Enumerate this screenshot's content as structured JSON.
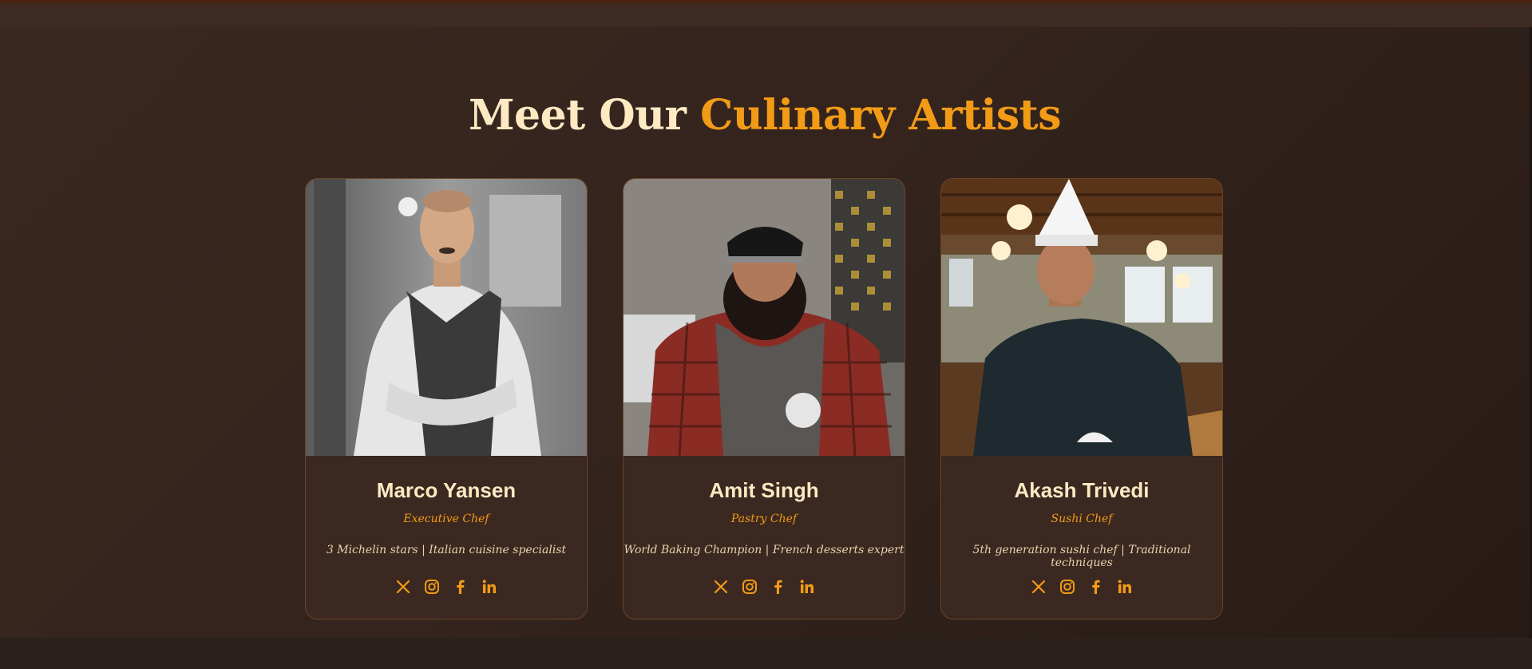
{
  "heading": {
    "part1": "Meet Our",
    "part2": "Culinary Artists"
  },
  "colors": {
    "accent": "#f29b16",
    "heading_light": "#fde9c2",
    "card_bg": "#3b2820",
    "card_border": "#6b4326",
    "page_bg": "#2a1d18"
  },
  "chefs": [
    {
      "name": "Marco Yansen",
      "role": "Executive Chef",
      "bio": "3 Michelin stars | Italian cuisine specialist",
      "photo": "chef-photo-grey-apron-arms-crossed",
      "socials": [
        "x-icon",
        "instagram-icon",
        "facebook-icon",
        "linkedin-icon"
      ]
    },
    {
      "name": "Amit Singh",
      "role": "Pastry Chef",
      "bio": "World Baking Champion | French desserts expert",
      "photo": "chef-photo-plaid-shirt-black-cap",
      "socials": [
        "x-icon",
        "instagram-icon",
        "facebook-icon",
        "linkedin-icon"
      ]
    },
    {
      "name": "Akash Trivedi",
      "role": "Sushi Chef",
      "bio": "5th generation sushi chef | Traditional techniques",
      "photo": "chef-photo-black-jacket-white-hat",
      "socials": [
        "x-icon",
        "instagram-icon",
        "facebook-icon",
        "linkedin-icon"
      ]
    }
  ]
}
